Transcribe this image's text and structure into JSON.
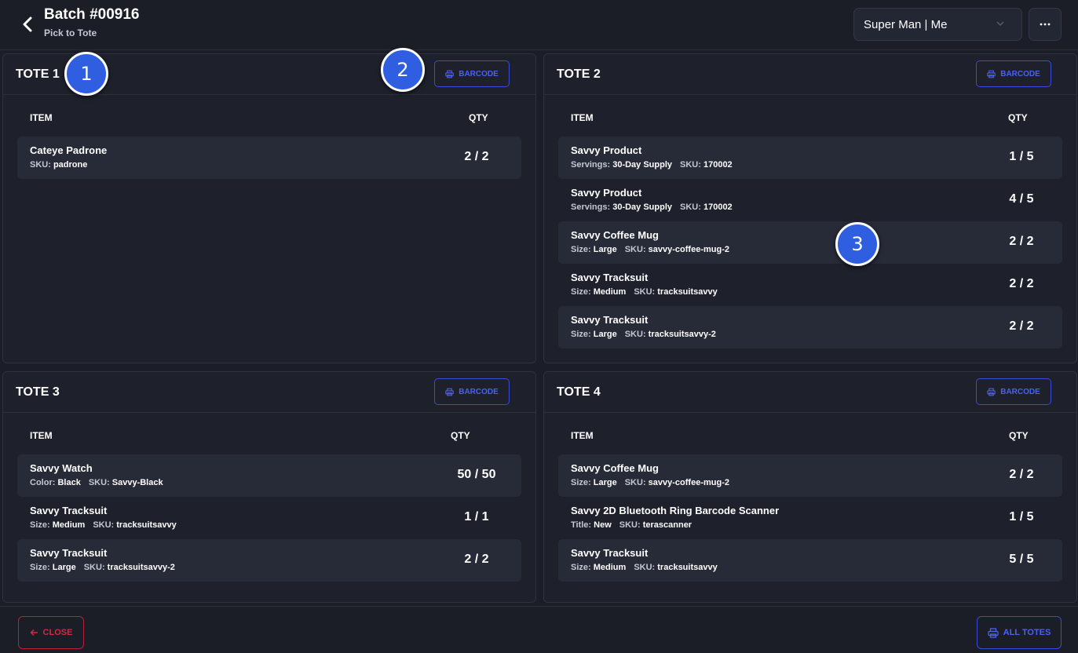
{
  "header": {
    "title": "Batch #00916",
    "subtitle": "Pick to Tote",
    "user_select": "Super Man | Me",
    "more_label": "···"
  },
  "colors": {
    "accent": "#4a62f0",
    "danger": "#d12a43",
    "background": "#1b1d27",
    "panel": "#1e202b",
    "row_shade": "#272a37"
  },
  "totes": [
    {
      "title": "TOTE 1",
      "barcode_label": "BARCODE",
      "col_item": "ITEM",
      "col_qty": "QTY",
      "items": [
        {
          "name": "Cateye Padrone",
          "attrs": [
            {
              "k": "SKU:",
              "v": "padrone"
            }
          ],
          "qty": "2 / 2"
        }
      ]
    },
    {
      "title": "TOTE 2",
      "barcode_label": "BARCODE",
      "col_item": "ITEM",
      "col_qty": "QTY",
      "items": [
        {
          "name": "Savvy Product",
          "attrs": [
            {
              "k": "Servings:",
              "v": "30-Day Supply"
            },
            {
              "k": "SKU:",
              "v": "170002"
            }
          ],
          "qty": "1 / 5"
        },
        {
          "name": "Savvy Product",
          "attrs": [
            {
              "k": "Servings:",
              "v": "30-Day Supply"
            },
            {
              "k": "SKU:",
              "v": "170002"
            }
          ],
          "qty": "4 / 5"
        },
        {
          "name": "Savvy Coffee Mug",
          "attrs": [
            {
              "k": "Size:",
              "v": "Large"
            },
            {
              "k": "SKU:",
              "v": "savvy-coffee-mug-2"
            }
          ],
          "qty": "2 / 2"
        },
        {
          "name": "Savvy Tracksuit",
          "attrs": [
            {
              "k": "Size:",
              "v": "Medium"
            },
            {
              "k": "SKU:",
              "v": "tracksuitsavvy"
            }
          ],
          "qty": "2 / 2"
        },
        {
          "name": "Savvy Tracksuit",
          "attrs": [
            {
              "k": "Size:",
              "v": "Large"
            },
            {
              "k": "SKU:",
              "v": "tracksuitsavvy-2"
            }
          ],
          "qty": "2 / 2"
        }
      ]
    },
    {
      "title": "TOTE 3",
      "barcode_label": "BARCODE",
      "col_item": "ITEM",
      "col_qty": "QTY",
      "items": [
        {
          "name": "Savvy Watch",
          "attrs": [
            {
              "k": "Color:",
              "v": "Black"
            },
            {
              "k": "SKU:",
              "v": "Savvy-Black"
            }
          ],
          "qty": "50 / 50"
        },
        {
          "name": "Savvy Tracksuit",
          "attrs": [
            {
              "k": "Size:",
              "v": "Medium"
            },
            {
              "k": "SKU:",
              "v": "tracksuitsavvy"
            }
          ],
          "qty": "1 / 1"
        },
        {
          "name": "Savvy Tracksuit",
          "attrs": [
            {
              "k": "Size:",
              "v": "Large"
            },
            {
              "k": "SKU:",
              "v": "tracksuitsavvy-2"
            }
          ],
          "qty": "2 / 2"
        }
      ]
    },
    {
      "title": "TOTE 4",
      "barcode_label": "BARCODE",
      "col_item": "ITEM",
      "col_qty": "QTY",
      "items": [
        {
          "name": "Savvy Coffee Mug",
          "attrs": [
            {
              "k": "Size:",
              "v": "Large"
            },
            {
              "k": "SKU:",
              "v": "savvy-coffee-mug-2"
            }
          ],
          "qty": "2 / 2"
        },
        {
          "name": "Savvy 2D Bluetooth Ring Barcode Scanner",
          "attrs": [
            {
              "k": "Title:",
              "v": "New"
            },
            {
              "k": "SKU:",
              "v": "terascanner"
            }
          ],
          "qty": "1 / 5"
        },
        {
          "name": "Savvy Tracksuit",
          "attrs": [
            {
              "k": "Size:",
              "v": "Medium"
            },
            {
              "k": "SKU:",
              "v": "tracksuitsavvy"
            }
          ],
          "qty": "5 / 5"
        }
      ]
    }
  ],
  "footer": {
    "close_label": "CLOSE",
    "all_totes_label": "ALL TOTES"
  },
  "markers": [
    "1",
    "2",
    "3"
  ]
}
